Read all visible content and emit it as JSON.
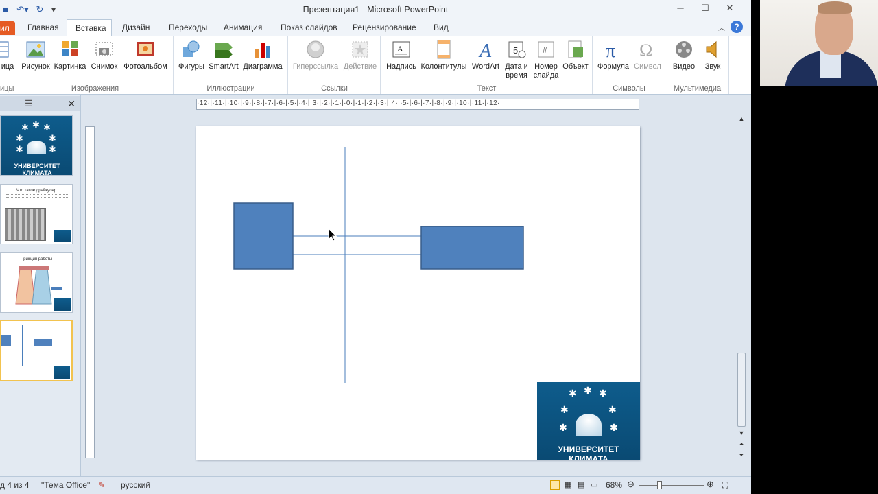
{
  "window": {
    "title": "Презентация1  -  Microsoft PowerPoint"
  },
  "tabs": {
    "file": "ил",
    "home": "Главная",
    "insert": "Вставка",
    "design": "Дизайн",
    "transitions": "Переходы",
    "animation": "Анимация",
    "slideshow": "Показ слайдов",
    "review": "Рецензирование",
    "view": "Вид"
  },
  "ribbon": {
    "tables": {
      "btn": "ица",
      "group": "ицы"
    },
    "images": {
      "group": "Изображения",
      "picture": "Рисунок",
      "clipart": "Картинка",
      "screenshot": "Снимок",
      "album": "Фотоальбом"
    },
    "illustrations": {
      "group": "Иллюстрации",
      "shapes": "Фигуры",
      "smartart": "SmartArt",
      "chart": "Диаграмма"
    },
    "links": {
      "group": "Ссылки",
      "hyperlink": "Гиперссылка",
      "action": "Действие"
    },
    "text": {
      "group": "Текст",
      "textbox": "Надпись",
      "header": "Колонтитулы",
      "wordart": "WordArt",
      "datetime_1": "Дата и",
      "datetime_2": "время",
      "slidenum_1": "Номер",
      "slidenum_2": "слайда",
      "object": "Объект"
    },
    "symbols": {
      "group": "Символы",
      "equation": "Формула",
      "symbol": "Символ"
    },
    "media": {
      "group": "Мультимедиа",
      "video": "Видео",
      "audio": "Звук"
    }
  },
  "ruler": {
    "h_ticks": "·12·|·11·|·10·|·9·|·8·|·7·|·6·|·5·|·4·|·3·|·2·|·1·|·0·|·1·|·2·|·3·|·4·|·5·|·6·|·7·|·8·|·9·|·10·|·11·|·12·"
  },
  "thumbnails": {
    "s2_title": "Что такое драйкулер",
    "s3_title": "Принцип работы"
  },
  "logo": {
    "text": "УНИВЕРСИТЕТ КЛИМАТА"
  },
  "status": {
    "slide": "д 4 из 4",
    "theme": "\"Тема Office\"",
    "language": "русский",
    "zoom": "68%"
  },
  "colors": {
    "shape_fill": "#4f81bd",
    "shape_border": "#385d8a",
    "line": "#4a7ebb",
    "accent_file": "#e55b24"
  }
}
